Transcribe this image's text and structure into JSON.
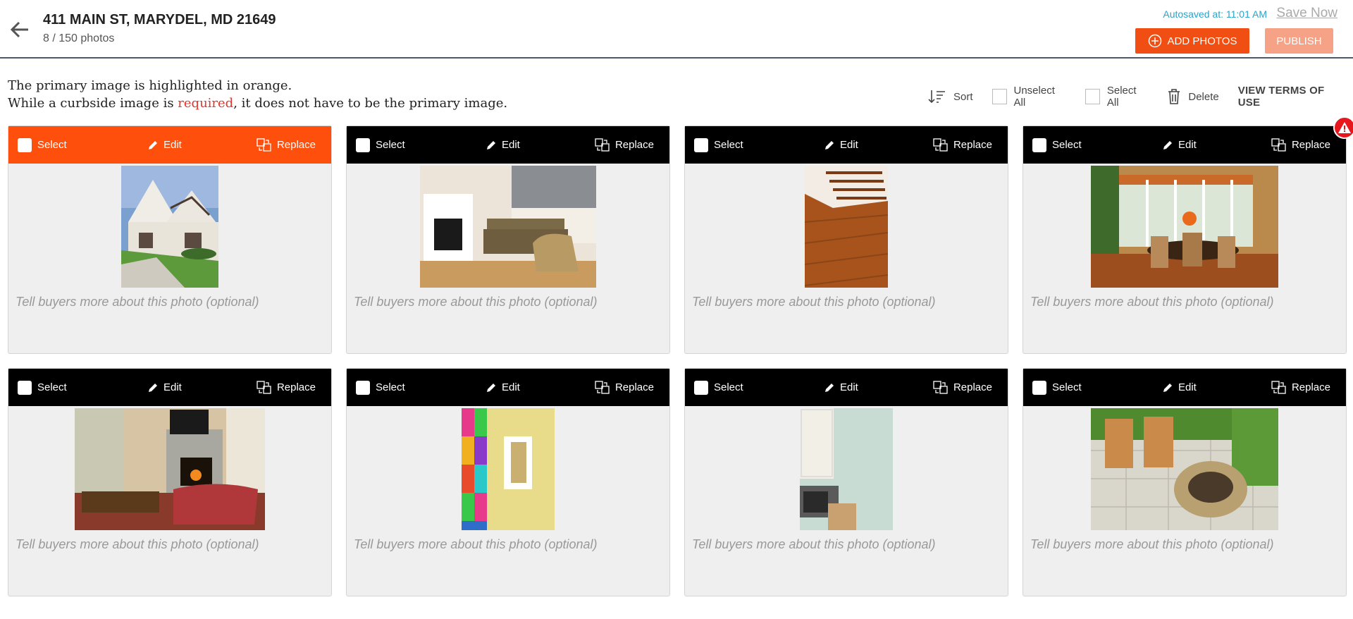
{
  "header": {
    "address": "411 MAIN ST, MARYDEL, MD 21649",
    "photo_count": "8 / 150 photos",
    "autosave": "Autosaved at: 11:01 AM",
    "save_now": "Save Now",
    "add_photos": "ADD PHOTOS",
    "publish": "PUBLISH"
  },
  "info": {
    "line1": "The primary image is highlighted in orange.",
    "line2_a": "While a curbside image is ",
    "line2_req": "required",
    "line2_b": ", it does not have to be the primary image."
  },
  "toolbar": {
    "sort": "Sort",
    "unselect_all": "Unselect All",
    "select_all": "Select All",
    "delete": "Delete",
    "terms": "VIEW TERMS OF USE"
  },
  "card_labels": {
    "select": "Select",
    "edit": "Edit",
    "replace": "Replace",
    "caption_placeholder": "Tell buyers more about this photo (optional)"
  },
  "cards": [
    {
      "subject": "house exterior",
      "primary": true
    },
    {
      "subject": "living room with fireplace"
    },
    {
      "subject": "hardwood floor and stairs"
    },
    {
      "subject": "dining room",
      "warning": true
    },
    {
      "subject": "family room with fireplace"
    },
    {
      "subject": "colorful art wall"
    },
    {
      "subject": "kitchen corner"
    },
    {
      "subject": "patio with fire pit"
    }
  ],
  "colors": {
    "accent": "#ff4f0c",
    "header_border": "#4a5a6a",
    "autosave": "#2aa3c9",
    "required": "#e0362c"
  }
}
